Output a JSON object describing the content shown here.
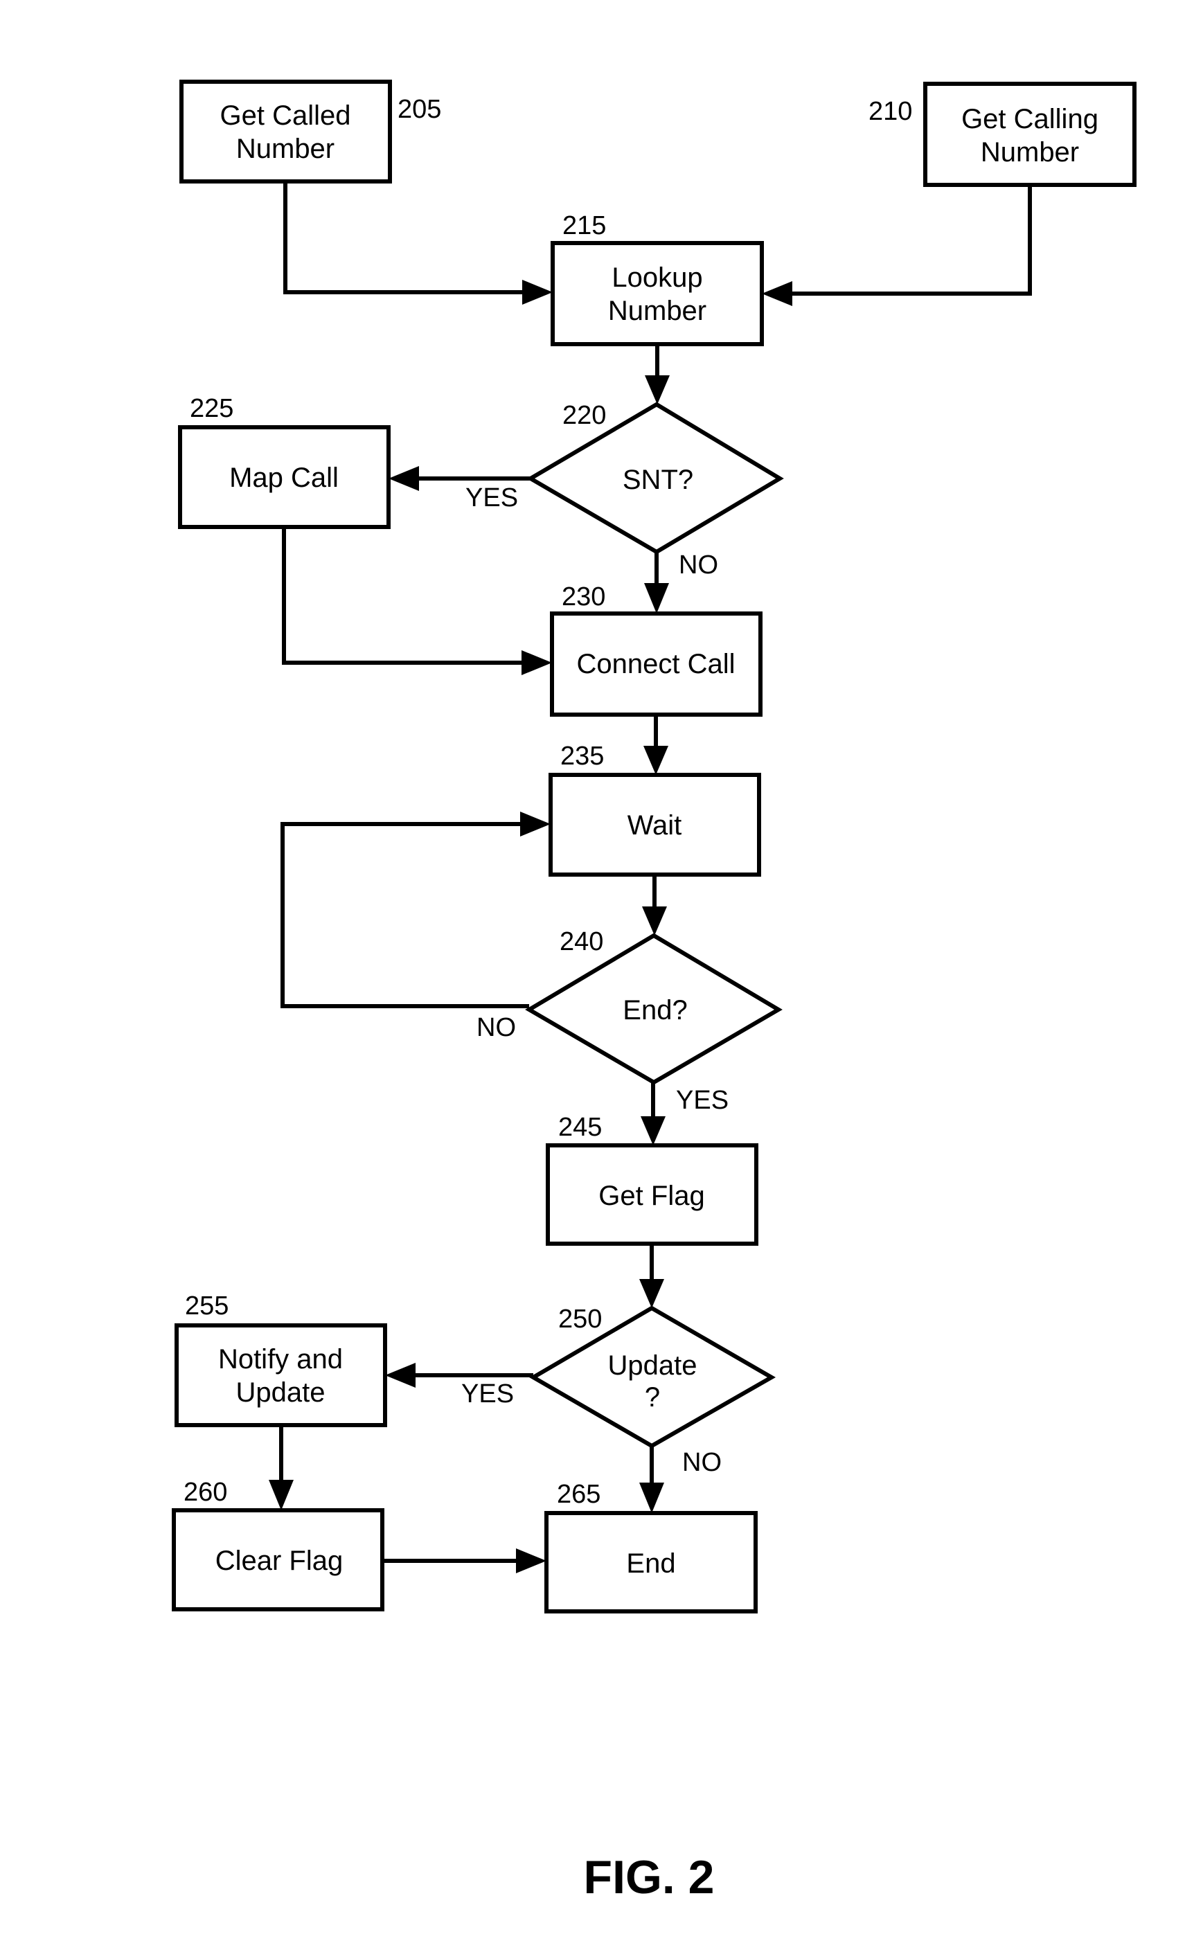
{
  "figure": {
    "title": "FIG. 2"
  },
  "nodes": {
    "n205": {
      "ref": "205",
      "lines": [
        "Get Called",
        "Number"
      ],
      "shape": "process"
    },
    "n210": {
      "ref": "210",
      "lines": [
        "Get Calling",
        "Number"
      ],
      "shape": "process"
    },
    "n215": {
      "ref": "215",
      "lines": [
        "Lookup",
        "Number"
      ],
      "shape": "process"
    },
    "n220": {
      "ref": "220",
      "lines": [
        "SNT?"
      ],
      "shape": "decision"
    },
    "n225": {
      "ref": "225",
      "lines": [
        "Map Call"
      ],
      "shape": "process"
    },
    "n230": {
      "ref": "230",
      "lines": [
        "Connect Call"
      ],
      "shape": "process"
    },
    "n235": {
      "ref": "235",
      "lines": [
        "Wait"
      ],
      "shape": "process"
    },
    "n240": {
      "ref": "240",
      "lines": [
        "End?"
      ],
      "shape": "decision"
    },
    "n245": {
      "ref": "245",
      "lines": [
        "Get Flag"
      ],
      "shape": "process"
    },
    "n250": {
      "ref": "250",
      "lines": [
        "Update",
        "?"
      ],
      "shape": "decision"
    },
    "n255": {
      "ref": "255",
      "lines": [
        "Notify and",
        "Update"
      ],
      "shape": "process"
    },
    "n260": {
      "ref": "260",
      "lines": [
        "Clear Flag"
      ],
      "shape": "process"
    },
    "n265": {
      "ref": "265",
      "lines": [
        "End"
      ],
      "shape": "process"
    }
  },
  "edges": [
    {
      "from": "205",
      "to": "215",
      "label": ""
    },
    {
      "from": "210",
      "to": "215",
      "label": ""
    },
    {
      "from": "215",
      "to": "220",
      "label": ""
    },
    {
      "from": "220",
      "to": "225",
      "label": "YES"
    },
    {
      "from": "220",
      "to": "230",
      "label": "NO"
    },
    {
      "from": "225",
      "to": "230",
      "label": ""
    },
    {
      "from": "230",
      "to": "235",
      "label": ""
    },
    {
      "from": "235",
      "to": "240",
      "label": ""
    },
    {
      "from": "240",
      "to": "235",
      "label": "NO"
    },
    {
      "from": "240",
      "to": "245",
      "label": "YES"
    },
    {
      "from": "245",
      "to": "250",
      "label": ""
    },
    {
      "from": "250",
      "to": "255",
      "label": "YES"
    },
    {
      "from": "250",
      "to": "265",
      "label": "NO"
    },
    {
      "from": "255",
      "to": "260",
      "label": ""
    },
    {
      "from": "260",
      "to": "265",
      "label": ""
    }
  ],
  "edge_labels": {
    "e220_yes": "YES",
    "e220_no": "NO",
    "e240_no": "NO",
    "e240_yes": "YES",
    "e250_yes": "YES",
    "e250_no": "NO"
  }
}
